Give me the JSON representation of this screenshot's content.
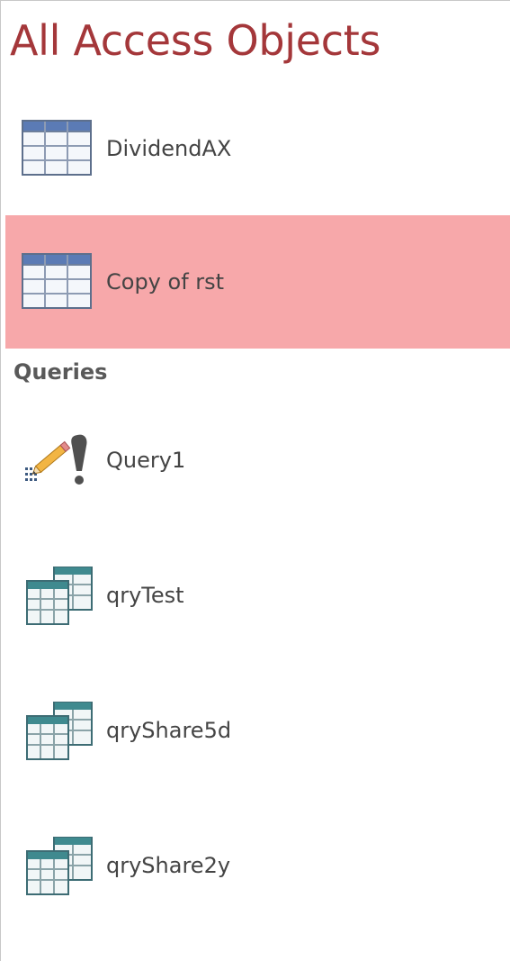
{
  "pane": {
    "title": "All Access Objects"
  },
  "tables": {
    "items": [
      {
        "label": "DividendAX",
        "icon": "table-icon",
        "selected": false
      },
      {
        "label": "Copy of rst",
        "icon": "table-icon",
        "selected": true
      }
    ]
  },
  "queries": {
    "header": "Queries",
    "items": [
      {
        "label": "Query1",
        "icon": "action-query-icon"
      },
      {
        "label": "qryTest",
        "icon": "select-query-icon"
      },
      {
        "label": "qryShare5d",
        "icon": "select-query-icon"
      },
      {
        "label": "qryShare2y",
        "icon": "select-query-icon"
      }
    ]
  },
  "colors": {
    "title": "#a4373a",
    "selected_background": "#f7a8aa",
    "table_icon_header": "#5b7bb5",
    "query_icon_header": "#3f8a8f"
  }
}
